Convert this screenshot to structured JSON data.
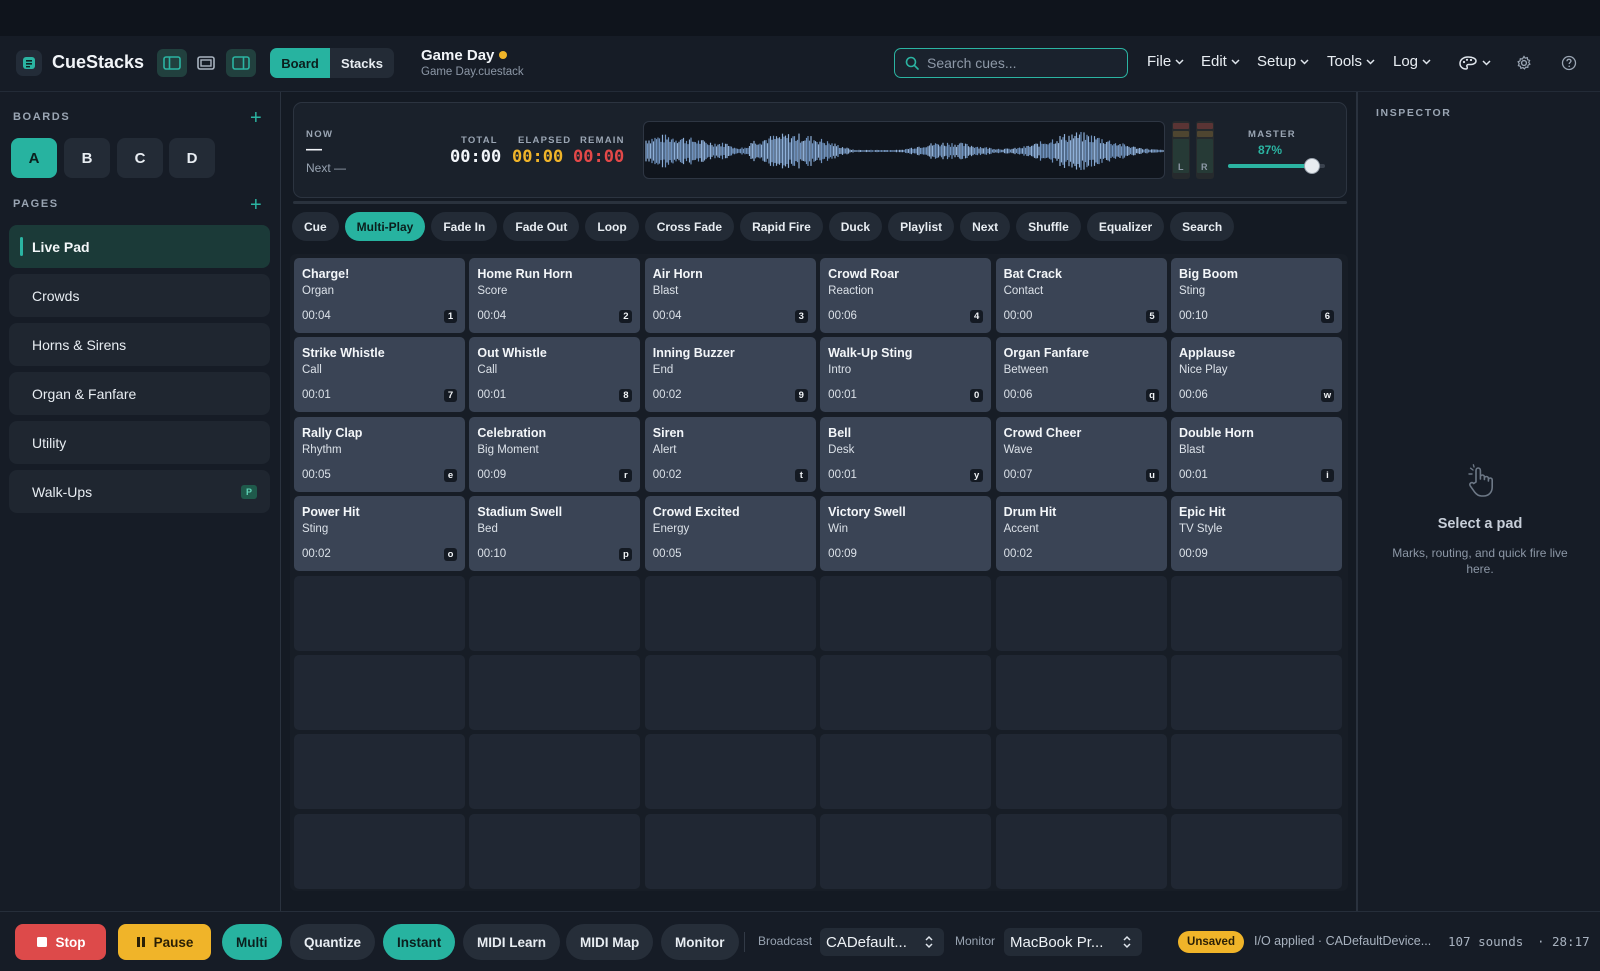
{
  "app": {
    "name": "CueStacks"
  },
  "header": {
    "view_tabs": [
      "Board",
      "Stacks"
    ],
    "doc_title": "Game Day",
    "doc_file": "Game Day.cuestack",
    "search_placeholder": "Search cues...",
    "menus": [
      "File",
      "Edit",
      "Setup",
      "Tools",
      "Log"
    ]
  },
  "sidebar": {
    "boards_label": "BOARDS",
    "boards": [
      "A",
      "B",
      "C",
      "D"
    ],
    "pages_label": "PAGES",
    "pages": [
      {
        "label": "Live Pad",
        "badge": ""
      },
      {
        "label": "Crowds",
        "badge": ""
      },
      {
        "label": "Horns & Sirens",
        "badge": ""
      },
      {
        "label": "Organ & Fanfare",
        "badge": ""
      },
      {
        "label": "Utility",
        "badge": ""
      },
      {
        "label": "Walk-Ups",
        "badge": "P"
      }
    ]
  },
  "transport": {
    "now_label": "NOW",
    "now_value": "—",
    "next_value": "Next —",
    "total_label": "TOTAL",
    "total_value": "00:00",
    "elapsed_label": "ELAPSED",
    "elapsed_value": "00:00",
    "remain_label": "REMAIN",
    "remain_value": "00:00",
    "meter_left": "L",
    "meter_right": "R",
    "master_label": "MASTER",
    "master_value": "87%",
    "master_level": 0.87
  },
  "modes": [
    "Cue",
    "Multi-Play",
    "Fade In",
    "Fade Out",
    "Loop",
    "Cross Fade",
    "Rapid Fire",
    "Duck",
    "Playlist",
    "Next",
    "Shuffle",
    "Equalizer",
    "Search"
  ],
  "active_mode": "Multi-Play",
  "pads": [
    {
      "title": "Charge!",
      "sub": "Organ",
      "dur": "00:04",
      "key": "1"
    },
    {
      "title": "Home Run Horn",
      "sub": "Score",
      "dur": "00:04",
      "key": "2"
    },
    {
      "title": "Air Horn",
      "sub": "Blast",
      "dur": "00:04",
      "key": "3"
    },
    {
      "title": "Crowd Roar",
      "sub": "Reaction",
      "dur": "00:06",
      "key": "4"
    },
    {
      "title": "Bat Crack",
      "sub": "Contact",
      "dur": "00:00",
      "key": "5"
    },
    {
      "title": "Big Boom",
      "sub": "Sting",
      "dur": "00:10",
      "key": "6"
    },
    {
      "title": "Strike Whistle",
      "sub": "Call",
      "dur": "00:01",
      "key": "7"
    },
    {
      "title": "Out Whistle",
      "sub": "Call",
      "dur": "00:01",
      "key": "8"
    },
    {
      "title": "Inning Buzzer",
      "sub": "End",
      "dur": "00:02",
      "key": "9"
    },
    {
      "title": "Walk-Up Sting",
      "sub": "Intro",
      "dur": "00:01",
      "key": "0"
    },
    {
      "title": "Organ Fanfare",
      "sub": "Between",
      "dur": "00:06",
      "key": "q"
    },
    {
      "title": "Applause",
      "sub": "Nice Play",
      "dur": "00:06",
      "key": "w"
    },
    {
      "title": "Rally Clap",
      "sub": "Rhythm",
      "dur": "00:05",
      "key": "e"
    },
    {
      "title": "Celebration",
      "sub": "Big Moment",
      "dur": "00:09",
      "key": "r"
    },
    {
      "title": "Siren",
      "sub": "Alert",
      "dur": "00:02",
      "key": "t"
    },
    {
      "title": "Bell",
      "sub": "Desk",
      "dur": "00:01",
      "key": "y"
    },
    {
      "title": "Crowd Cheer",
      "sub": "Wave",
      "dur": "00:07",
      "key": "u"
    },
    {
      "title": "Double Horn",
      "sub": "Blast",
      "dur": "00:01",
      "key": "i"
    },
    {
      "title": "Power Hit",
      "sub": "Sting",
      "dur": "00:02",
      "key": "o"
    },
    {
      "title": "Stadium Swell",
      "sub": "Bed",
      "dur": "00:10",
      "key": "p"
    },
    {
      "title": "Crowd Excited",
      "sub": "Energy",
      "dur": "00:05",
      "key": ""
    },
    {
      "title": "Victory Swell",
      "sub": "Win",
      "dur": "00:09",
      "key": ""
    },
    {
      "title": "Drum Hit",
      "sub": "Accent",
      "dur": "00:02",
      "key": ""
    },
    {
      "title": "Epic Hit",
      "sub": "TV Style",
      "dur": "00:09",
      "key": ""
    }
  ],
  "empty_pad_count": 24,
  "inspector": {
    "label": "INSPECTOR",
    "title": "Select a pad",
    "desc": "Marks, routing, and quick fire live here."
  },
  "footer": {
    "stop": "Stop",
    "pause": "Pause",
    "multi": "Multi",
    "quantize": "Quantize",
    "instant": "Instant",
    "midi_learn": "MIDI Learn",
    "midi_map": "MIDI Map",
    "monitor_btn": "Monitor",
    "broadcast_label": "Broadcast",
    "broadcast_value": "CADefault...",
    "monitor_label": "Monitor",
    "monitor_value": "MacBook Pr...",
    "unsaved": "Unsaved",
    "status": "I/O applied · CADefaultDevice...",
    "sounds": "107 sounds",
    "sep": "·",
    "clock": "28:17"
  },
  "colors": {
    "accent": "#27b3a0",
    "warn": "#f0b429",
    "danger": "#dd4a4a",
    "pad": "#3a4455",
    "bg": "#141a23"
  }
}
